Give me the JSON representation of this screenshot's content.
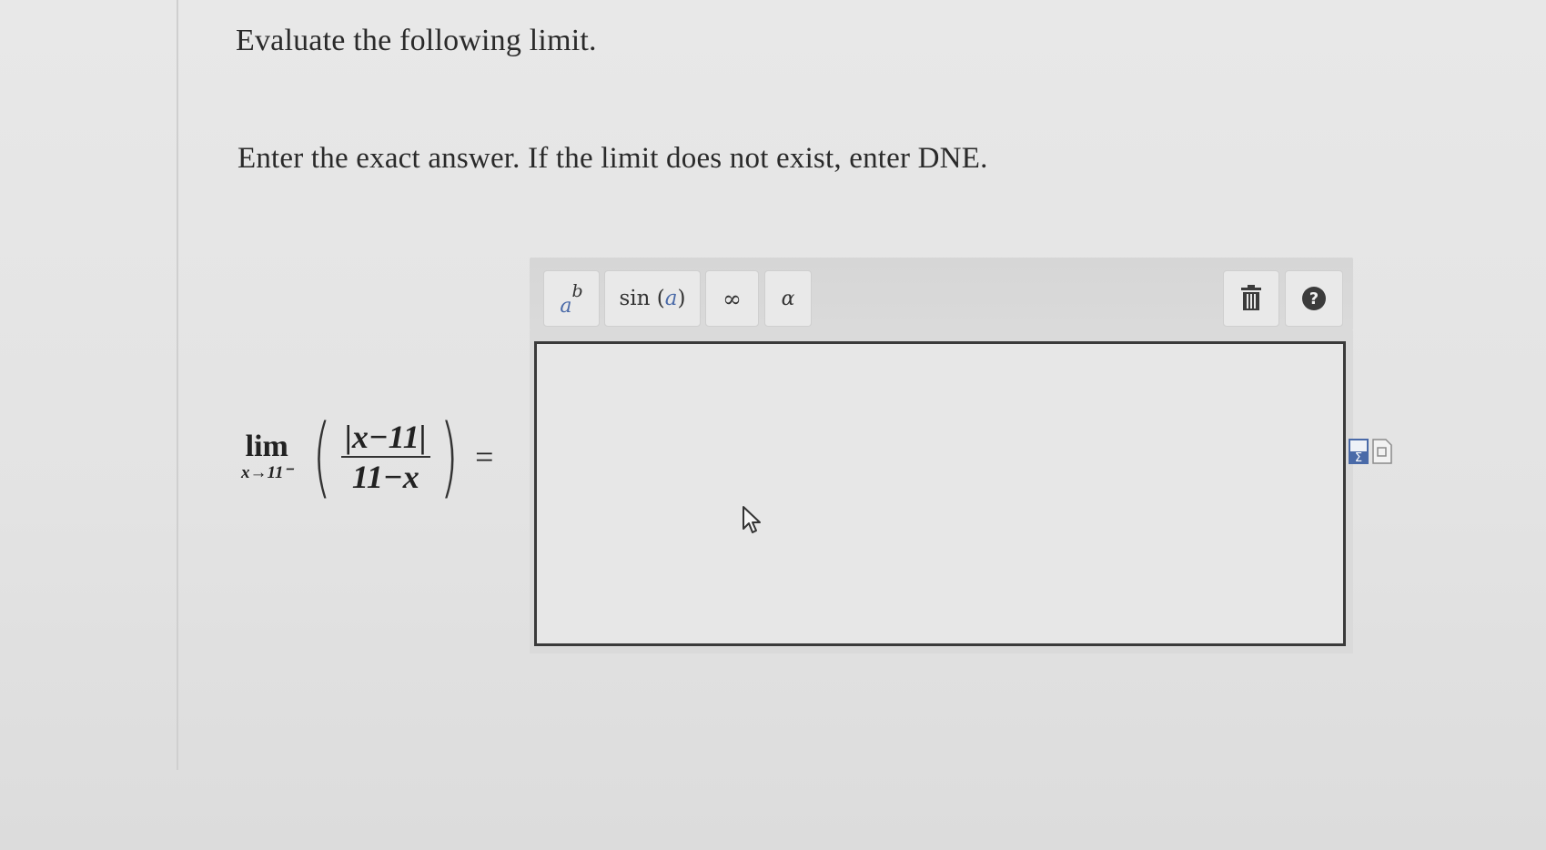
{
  "question": {
    "title": "Evaluate the following limit.",
    "instructions": "Enter the exact answer. If the limit does not exist, enter DNE."
  },
  "expression": {
    "lim_word": "lim",
    "lim_subscript": "x→11⁻",
    "numerator": "|x−11|",
    "denominator": "11−x",
    "equals": "="
  },
  "toolbar": {
    "buttons": [
      {
        "name": "power",
        "label_base": "a",
        "label_exp": "b"
      },
      {
        "name": "sin",
        "label_func": "sin",
        "label_arg": "a"
      },
      {
        "name": "infinity",
        "label": "∞"
      },
      {
        "name": "alpha",
        "label": "α"
      },
      {
        "name": "trash",
        "icon": "trash-icon"
      },
      {
        "name": "help",
        "icon": "question-icon",
        "label": "?"
      }
    ]
  },
  "answer": {
    "value": "",
    "placeholder": ""
  },
  "icons": {
    "cursor": "mouse-cursor-icon",
    "side": [
      "sigma-doc-icon",
      "page-doc-icon"
    ]
  },
  "colors": {
    "background": "#e4e4e4",
    "toolbar": "#d7d7d7",
    "answer_border": "#3a3a3a",
    "accent_blue": "#4a6aa8",
    "help_icon": "#3b3b3b"
  }
}
